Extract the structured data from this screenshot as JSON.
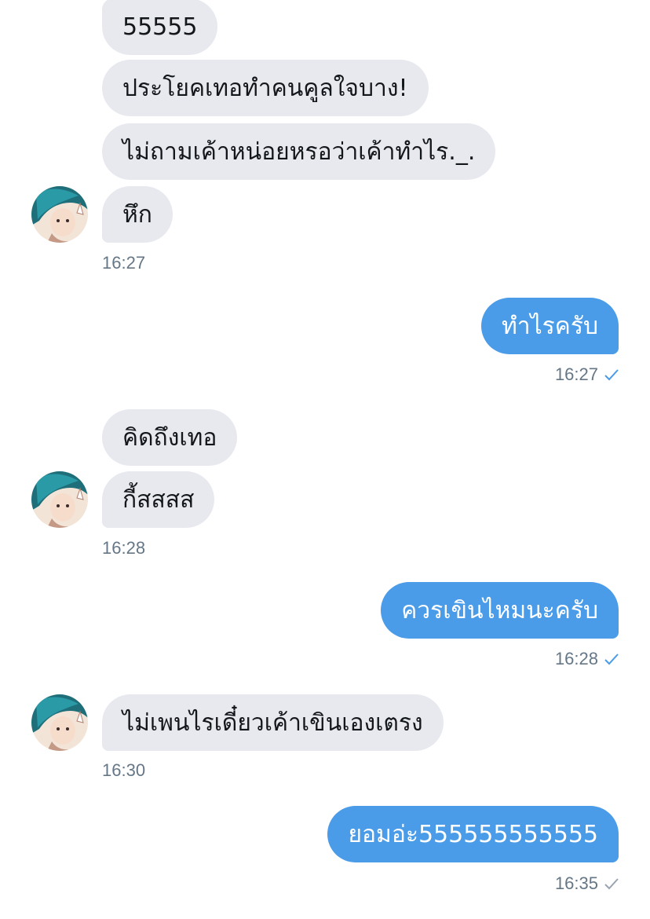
{
  "conversation": {
    "group1": {
      "messages": [
        "55555",
        "ประโยคเทอทำคนคูลใจบาง!",
        "ไม่ถามเค้าหน่อยหรอว่าเค้าทำไร._.",
        "หึก"
      ],
      "time": "16:27"
    },
    "reply1": {
      "message": "ทำไรครับ",
      "time": "16:27",
      "status": "read"
    },
    "group2": {
      "messages": [
        "คิดถึงเทอ",
        "กี้สสสส"
      ],
      "time": "16:28"
    },
    "reply2": {
      "message": "ควรเขินไหมนะครับ",
      "time": "16:28",
      "status": "read"
    },
    "group3": {
      "messages": [
        "ไม่เพนไรเดี๋ยวเค้าเขินเองเตรง"
      ],
      "time": "16:30"
    },
    "reply3": {
      "message": "ยอมอ่ะ555555555555",
      "time": "16:35",
      "status": "sent"
    }
  },
  "icons": {
    "avatar": "user-avatar",
    "read_check": "checkmark-icon",
    "sent_check": "checkmark-icon"
  },
  "colors": {
    "incoming_bubble": "#e7e9ef",
    "outgoing_bubble": "#4a9be8",
    "timestamp": "#657786",
    "read_check": "#4a9be8",
    "sent_check": "#9aa5b1"
  }
}
